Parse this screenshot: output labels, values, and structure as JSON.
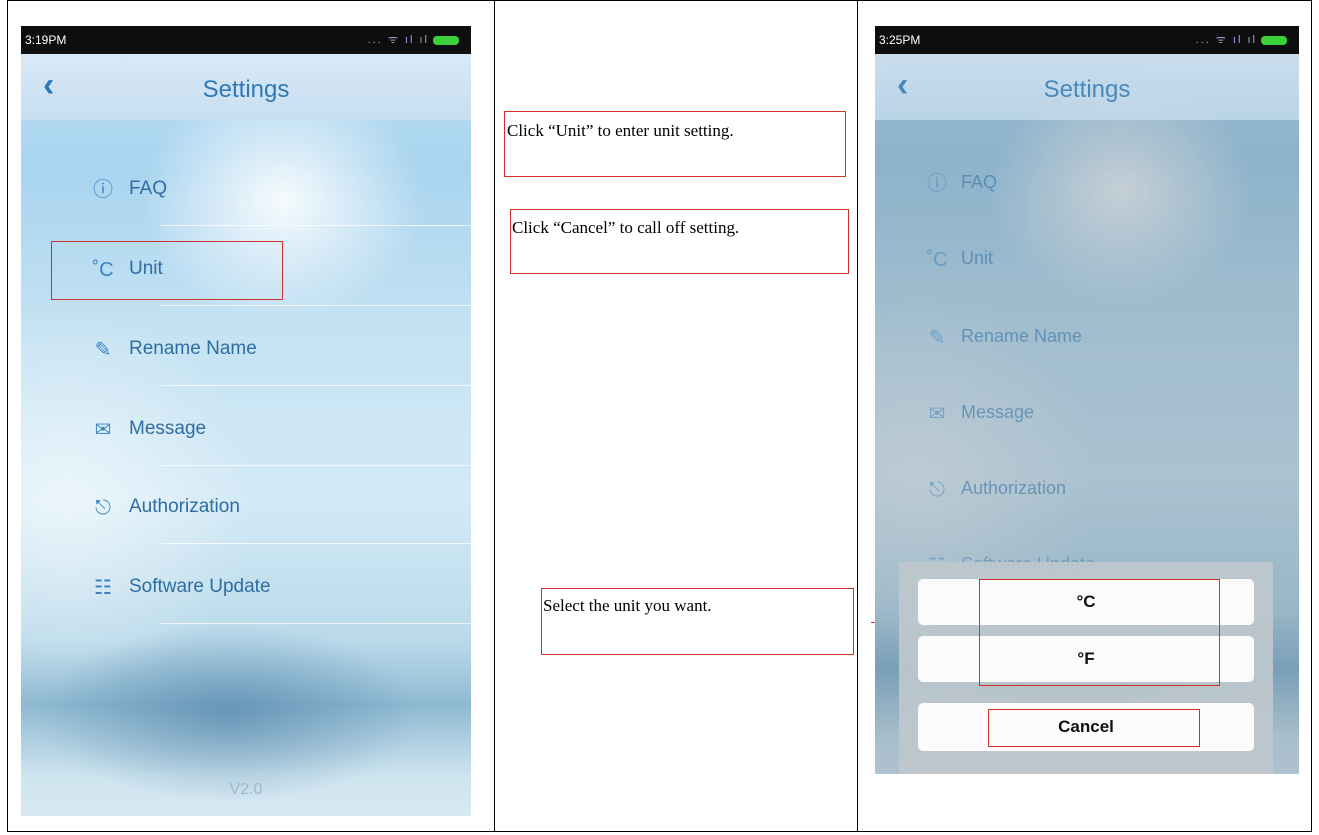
{
  "left_phone": {
    "status_time": "3:19PM",
    "status_icons": "... ᯤ ıl ıl",
    "back_icon": "chevron-left-icon",
    "title": "Settings",
    "menu": [
      {
        "icon": "info-icon",
        "glyph": "ⓘ",
        "label": "FAQ"
      },
      {
        "icon": "celsius-icon",
        "glyph": "˚C",
        "label": "Unit"
      },
      {
        "icon": "pencil-icon",
        "glyph": "✎",
        "label": "Rename Name"
      },
      {
        "icon": "envelope-icon",
        "glyph": "✉",
        "label": "Message"
      },
      {
        "icon": "lock-icon",
        "glyph": "🔓",
        "label": "Authorization"
      },
      {
        "icon": "globe-icon",
        "glyph": "🌐",
        "label": "Software Update"
      }
    ],
    "version": "V2.0"
  },
  "annotations": {
    "unit": "Click “Unit” to enter unit setting.",
    "cancel": "Click “Cancel” to call off setting.",
    "select": "Select the unit you want."
  },
  "right_phone": {
    "status_time": "3:25PM",
    "status_icons": "... ᯤ ıl ıl",
    "title": "Settings",
    "menu_labels": [
      "FAQ",
      "Unit",
      "Rename Name",
      "Message",
      "Authorization",
      "Software Update"
    ],
    "sheet": {
      "celsius": "°C",
      "fahrenheit": "°F",
      "cancel": "Cancel"
    }
  },
  "colors": {
    "accent": "#2d79b8",
    "annotation_red": "#d0312d"
  }
}
